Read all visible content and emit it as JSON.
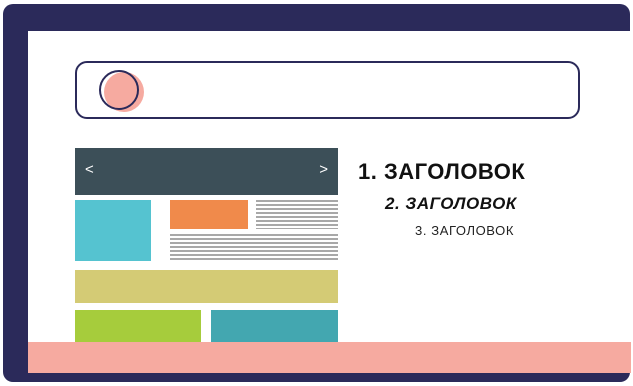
{
  "browser": {
    "nav_prev": "<",
    "nav_next": ">"
  },
  "headings": {
    "h1": "1. ЗАГОЛОВОК",
    "h2": "2. ЗАГОЛОВОК",
    "h3": "3. ЗАГОЛОВОК"
  },
  "colors": {
    "frame": "#2b2a5a",
    "accent_pink": "#f6aaa0",
    "nav_bar": "#3c4f58",
    "cyan": "#55c3d0",
    "orange": "#f08a4b",
    "olive": "#d4cb75",
    "green": "#a6cc3c",
    "teal": "#43a7b0"
  },
  "icons": {
    "search": "search-icon"
  }
}
